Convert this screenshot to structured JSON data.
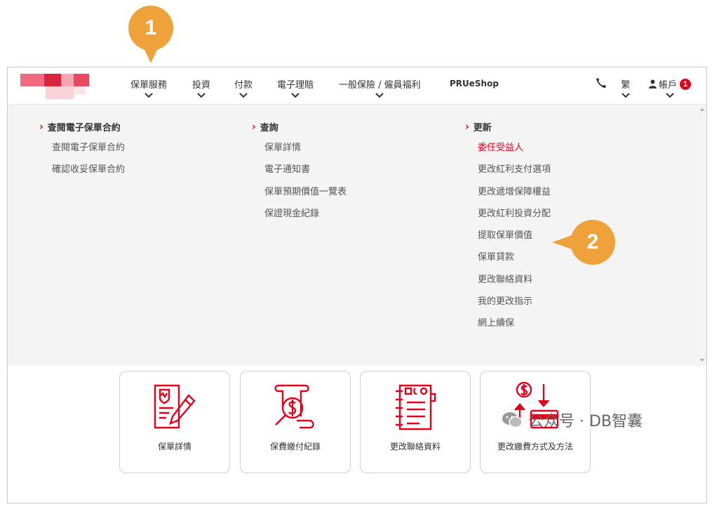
{
  "markers": {
    "one": "1",
    "two": "2"
  },
  "nav": {
    "items": [
      {
        "label": "保單服務"
      },
      {
        "label": "投資"
      },
      {
        "label": "付款"
      },
      {
        "label": "電子理賠"
      },
      {
        "label": "一般保險 / 僱員福利"
      }
    ],
    "shop": "PRUeShop",
    "language": "繁",
    "account": "帳戶",
    "account_badge": "1"
  },
  "menu": {
    "columns": [
      {
        "heading": "查閱電子保單合約",
        "items": [
          "查閱電子保單合約",
          "確認收妥保單合約"
        ]
      },
      {
        "heading": "查詢",
        "items": [
          "保單詳情",
          "電子通知書",
          "保單預期價值一覽表",
          "保證現金紀錄"
        ]
      },
      {
        "heading": "更新",
        "items": [
          "委任受益人",
          "更改紅利支付選項",
          "更改遞增保障權益",
          "更改紅利投資分配",
          "提取保單價值",
          "保單貸款",
          "更改聯絡資料",
          "我的更改指示",
          "網上續保"
        ]
      }
    ]
  },
  "tiles": [
    {
      "label": "保單詳情",
      "icon": "policy-document-icon"
    },
    {
      "label": "保費繳付紀錄",
      "icon": "payment-record-icon"
    },
    {
      "label": "更改聯絡資料",
      "icon": "contact-book-icon"
    },
    {
      "label": "更改繳費方式及方法",
      "icon": "payment-method-icon"
    }
  ],
  "watermark": "公众号 · DB智囊",
  "colors": {
    "accent": "#e3001b",
    "marker": "#f0a23a",
    "menu_bg": "#f4f4f4"
  }
}
